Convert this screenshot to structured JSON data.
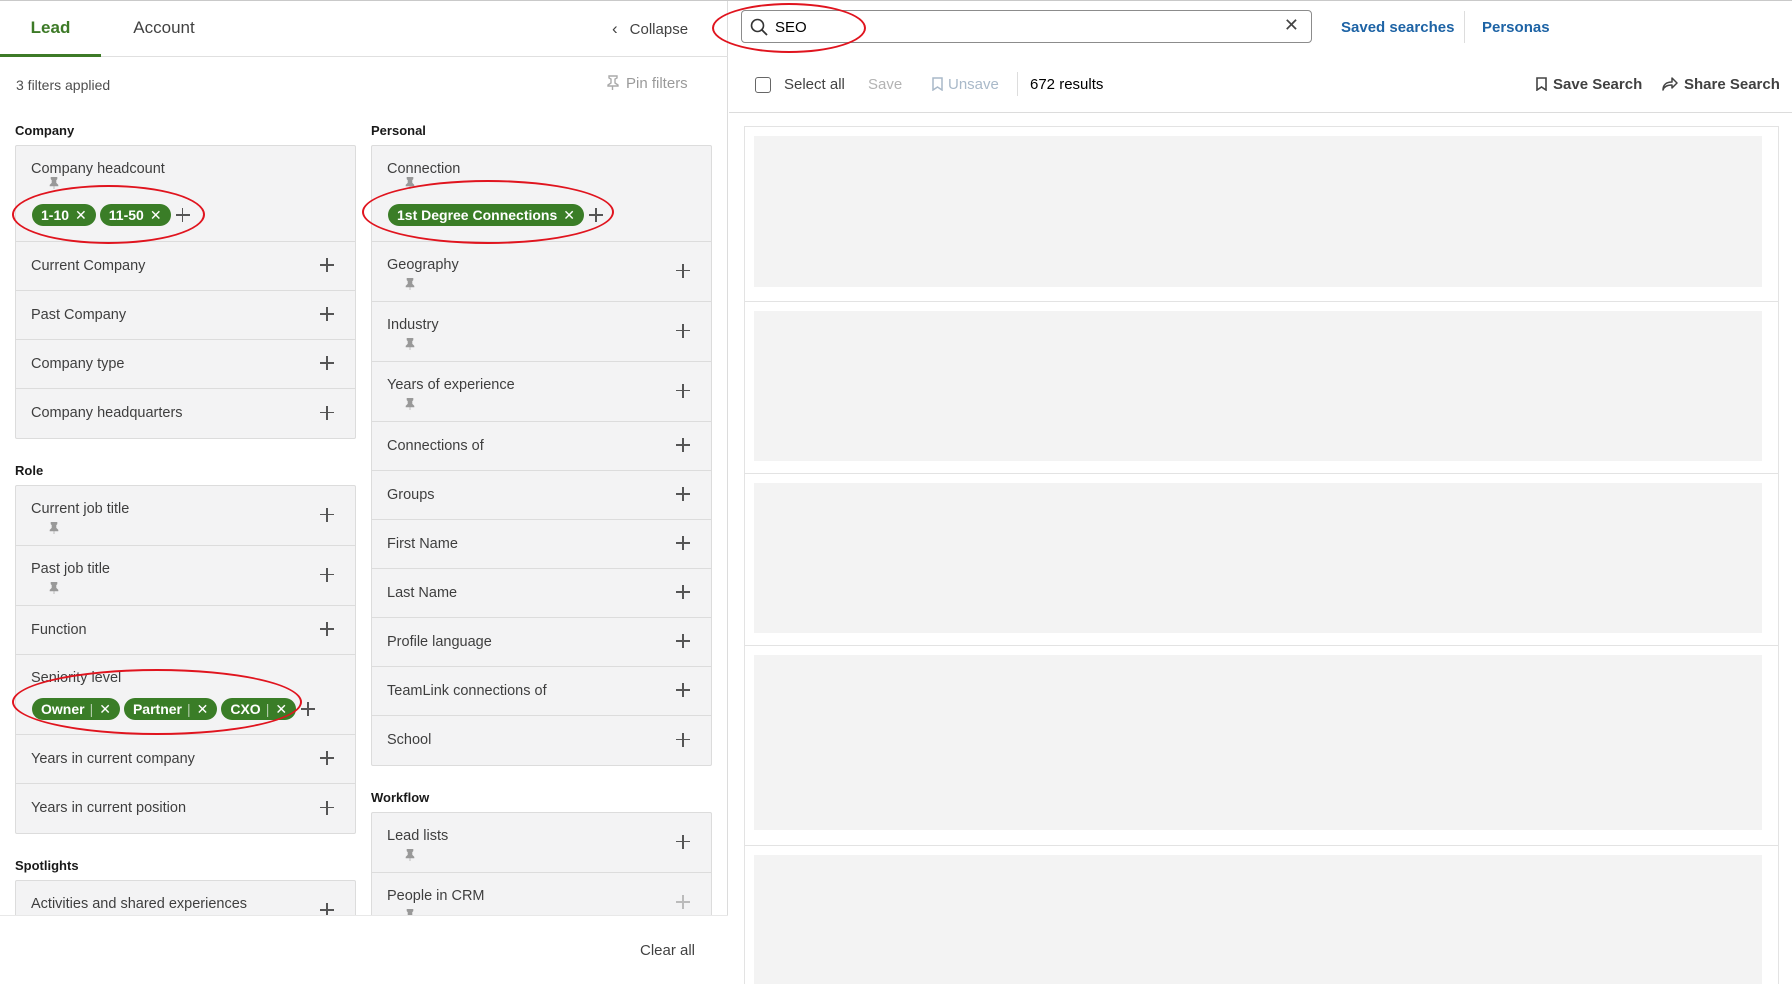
{
  "tabs": {
    "lead": "Lead",
    "account": "Account"
  },
  "collapse_label": "Collapse",
  "filters_applied": "3 filters applied",
  "pin_filters": "Pin filters",
  "company": {
    "title": "Company",
    "headcount_label": "Company headcount",
    "headcount_pills": [
      "1-10",
      "11-50"
    ],
    "items": [
      "Current Company",
      "Past Company",
      "Company type",
      "Company headquarters"
    ]
  },
  "role": {
    "title": "Role",
    "current_job_title": "Current job title",
    "past_job_title": "Past job title",
    "function": "Function",
    "seniority_label": "Seniority level",
    "seniority_pills": [
      "Owner",
      "Partner",
      "CXO"
    ],
    "years_company": "Years in current company",
    "years_position": "Years in current position"
  },
  "spotlights": {
    "title": "Spotlights",
    "activities": "Activities and shared experiences"
  },
  "personal": {
    "title": "Personal",
    "connection_label": "Connection",
    "connection_pill": "1st Degree Connections",
    "geography": "Geography",
    "industry": "Industry",
    "years_experience": "Years of experience",
    "items": [
      "Connections of",
      "Groups",
      "First Name",
      "Last Name",
      "Profile language",
      "TeamLink connections of",
      "School"
    ]
  },
  "workflow": {
    "title": "Workflow",
    "lead_lists": "Lead lists",
    "people_in_crm": "People in CRM"
  },
  "clear_all": "Clear all",
  "search": {
    "value": "SEO"
  },
  "saved_searches": "Saved searches",
  "personas": "Personas",
  "results_bar": {
    "select_all": "Select all",
    "save": "Save",
    "unsave": "Unsave",
    "count": "672 results",
    "save_search": "Save Search",
    "share_search": "Share Search"
  },
  "colors": {
    "accent_green": "#3a7d27",
    "link_blue": "#1d63a5",
    "annotation_red": "#e0141e"
  }
}
